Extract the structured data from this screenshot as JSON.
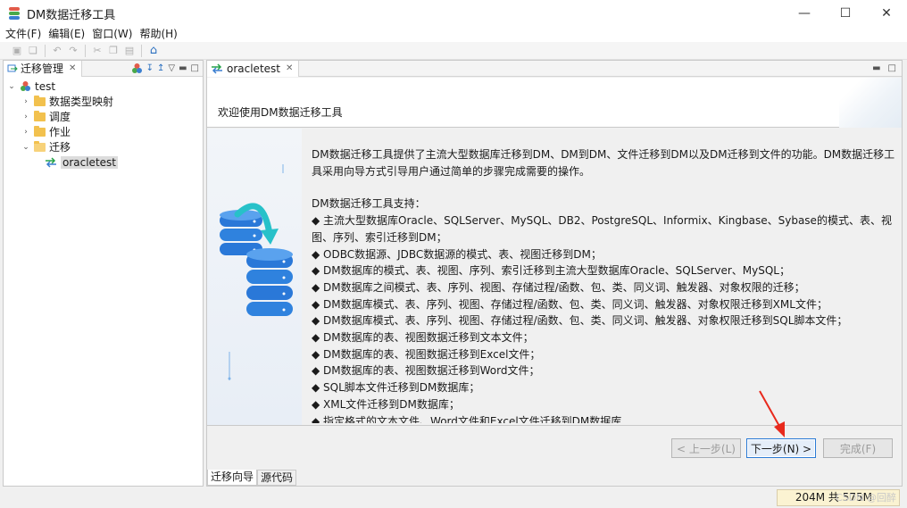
{
  "window": {
    "title": "DM数据迁移工具",
    "controls": [
      "minimize",
      "maximize",
      "close"
    ]
  },
  "menubar": {
    "items": [
      "文件(F)",
      "编辑(E)",
      "窗口(W)",
      "帮助(H)"
    ]
  },
  "left_panel": {
    "tab_label": "迁移管理",
    "tree": {
      "root": "test",
      "children": [
        {
          "label": "数据类型映射",
          "expanded": false
        },
        {
          "label": "调度",
          "expanded": false
        },
        {
          "label": "作业",
          "expanded": false
        },
        {
          "label": "迁移",
          "expanded": true
        }
      ],
      "selected_item": "oracletest"
    }
  },
  "editor": {
    "tab_label": "oracletest",
    "wizard_title": "欢迎使用DM数据迁移工具",
    "intro": "DM数据迁移工具提供了主流大型数据库迁移到DM、DM到DM、文件迁移到DM以及DM迁移到文件的功能。DM数据迁移工具采用向导方式引导用户通过简单的步骤完成需要的操作。",
    "support_heading": "DM数据迁移工具支持：",
    "features": [
      "◆ 主流大型数据库Oracle、SQLServer、MySQL、DB2、PostgreSQL、Informix、Kingbase、Sybase的模式、表、视图、序列、索引迁移到DM；",
      "◆ ODBC数据源、JDBC数据源的模式、表、视图迁移到DM；",
      "◆ DM数据库的模式、表、视图、序列、索引迁移到主流大型数据库Oracle、SQLServer、MySQL；",
      "◆ DM数据库之间模式、表、序列、视图、存储过程/函数、包、类、同义词、触发器、对象权限的迁移；",
      "◆ DM数据库模式、表、序列、视图、存储过程/函数、包、类、同义词、触发器、对象权限迁移到XML文件；",
      "◆ DM数据库模式、表、序列、视图、存储过程/函数、包、类、同义词、触发器、对象权限迁移到SQL脚本文件；",
      "◆ DM数据库的表、视图数据迁移到文本文件；",
      "◆ DM数据库的表、视图数据迁移到Excel文件；",
      "◆ DM数据库的表、视图数据迁移到Word文件；",
      "◆ SQL脚本文件迁移到DM数据库；",
      "◆ XML文件迁移到DM数据库；",
      "◆ 指定格式的文本文件、Word文件和Excel文件迁移到DM数据库"
    ],
    "buttons": {
      "back": "< 上一步(L)",
      "next": "下一步(N) >",
      "finish": "完成(F)"
    },
    "bottom_tabs": [
      "迁移向导",
      "源代码"
    ]
  },
  "status": {
    "heap": "204M 共 575M",
    "watermark": "CSDN @回醉"
  },
  "colors": {
    "accent": "#2c7bd6",
    "folder": "#f2c14e",
    "arrow": "#e8291c",
    "db_blue": "#2a78d8",
    "transfer_teal": "#27c1c9"
  }
}
